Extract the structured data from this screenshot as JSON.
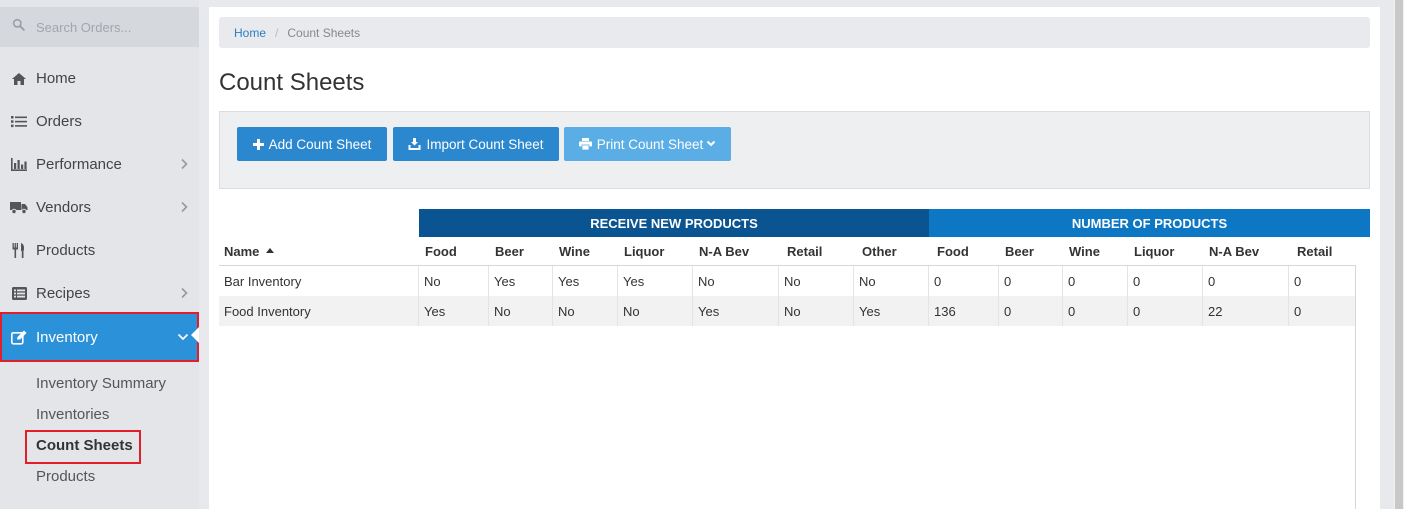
{
  "search": {
    "placeholder": "Search Orders..."
  },
  "nav": {
    "items": [
      {
        "label": "Home",
        "icon": "home-icon"
      },
      {
        "label": "Orders",
        "icon": "list-icon"
      },
      {
        "label": "Performance",
        "icon": "bar-chart-icon"
      },
      {
        "label": "Vendors",
        "icon": "truck-icon"
      },
      {
        "label": "Products",
        "icon": "cutlery-icon"
      },
      {
        "label": "Recipes",
        "icon": "list-alt-icon"
      },
      {
        "label": "Inventory",
        "icon": "edit-icon"
      }
    ],
    "sub_items": [
      "Inventory Summary",
      "Inventories",
      "Count Sheets",
      "Products"
    ]
  },
  "breadcrumb": {
    "home": "Home",
    "current": "Count Sheets"
  },
  "page": {
    "title": "Count Sheets"
  },
  "toolbar": {
    "add": "Add Count Sheet",
    "import": "Import Count Sheet",
    "print": "Print Count Sheet"
  },
  "table": {
    "groups": {
      "receive": "RECEIVE NEW PRODUCTS",
      "number": "NUMBER OF PRODUCTS"
    },
    "columns": [
      "Name",
      "Food",
      "Beer",
      "Wine",
      "Liquor",
      "N-A Bev",
      "Retail",
      "Other",
      "Food",
      "Beer",
      "Wine",
      "Liquor",
      "N-A Bev",
      "Retail"
    ],
    "rows": [
      [
        "Bar Inventory",
        "No",
        "Yes",
        "Yes",
        "Yes",
        "No",
        "No",
        "No",
        "0",
        "0",
        "0",
        "0",
        "0",
        "0"
      ],
      [
        "Food Inventory",
        "Yes",
        "No",
        "No",
        "No",
        "Yes",
        "No",
        "Yes",
        "136",
        "0",
        "0",
        "0",
        "22",
        "0"
      ]
    ]
  },
  "colors": {
    "active": "#2b91d9",
    "primary_btn": "#2b88cf",
    "print_btn": "#5aaee5",
    "group_receive": "#0a5591",
    "group_number": "#0e77c4",
    "highlight": "#e01f2a"
  }
}
